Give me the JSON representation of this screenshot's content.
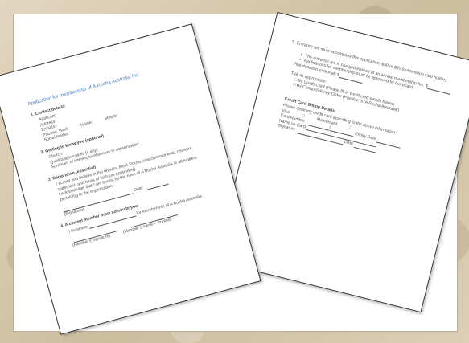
{
  "back_page": {
    "lines": [
      "5.   Entrance fee must accompany this application: $50 or $20 (concession card holder)",
      "The entrance fee is charged instead of an annual membership fee.",
      "Applications for membership must be approved by the Board.",
      "Plus donation (optional)",
      "Tick as appropriate:",
      "By Credit Card (Please fill in credit card details below)",
      "By Cheque/Money Order (Payable to 'A Rocha Australia')",
      "Credit Card Billing Details:",
      "Please debit my credit card according to the above information:",
      "Visa",
      "Mastercard",
      "Card Number",
      "Expiry Date",
      "Name on Card",
      "Signature",
      "Date"
    ],
    "currency": "$"
  },
  "front_page": {
    "title": "Application for membership of A Rocha Australia Inc.",
    "s1": {
      "heading": "1.   Contact details:",
      "fields": [
        "Applicant:",
        "Address:",
        "Email(s):",
        "Phones: Work",
        "Social media:"
      ],
      "home": "Home:",
      "mobile": "Mobile:"
    },
    "s2": {
      "heading": "2.   Getting to know you (optional)",
      "lines": [
        "Church:",
        "Qualifications/skills (if any):",
        "Summary of interest/involvement in conservation:"
      ]
    },
    "s3": {
      "heading": "3.   Declaration (essential)",
      "lines": [
        "I accept and believe in the objects, the A Rocha core commitments, mission",
        "statement, and basis of faith (as appended).",
        "I acknowledge that I am bound by the rules of A Rocha Australia in all matters",
        "pertaining to the organisation."
      ],
      "date": "Date:",
      "signature": "(Signature)"
    },
    "s4": {
      "heading": "4.   A current member must nominate you:",
      "nominate": "I nominate",
      "for_membership": "for membership of A Rocha Australia",
      "member_sig": "(Member's signature)",
      "member_name": "(Member's name – Printed)"
    }
  }
}
